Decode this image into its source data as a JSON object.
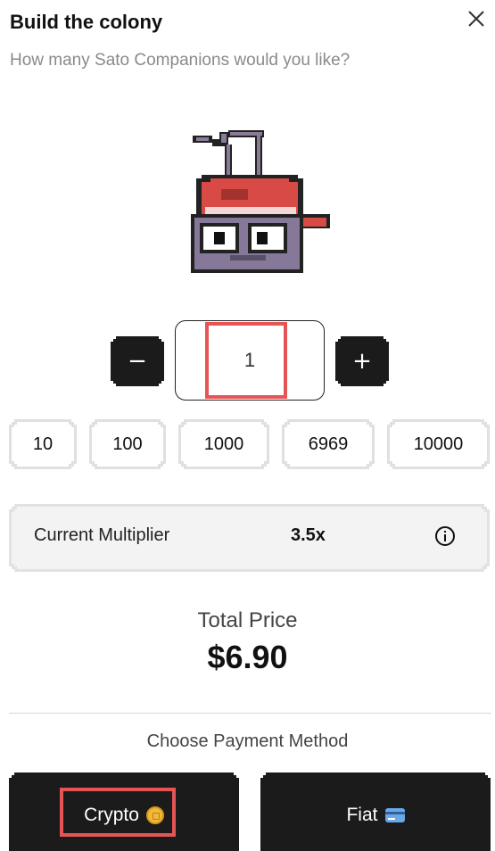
{
  "header": {
    "title": "Build the colony",
    "subtitle": "How many Sato Companions would you like?",
    "close_icon": "close-icon"
  },
  "mascot": {
    "icon": "sato-companion-mascot"
  },
  "quantity": {
    "value": "1",
    "decrement_label": "−",
    "increment_label": "+"
  },
  "presets": [
    "10",
    "100",
    "1000",
    "6969",
    "10000"
  ],
  "multiplier": {
    "label": "Current Multiplier",
    "value": "3.5x",
    "info_icon": "info-icon"
  },
  "total": {
    "label": "Total Price",
    "value": "$6.90"
  },
  "payment": {
    "label": "Choose Payment Method",
    "crypto_label": "Crypto",
    "crypto_icon": "coin-icon",
    "fiat_label": "Fiat",
    "fiat_icon": "credit-card-icon"
  },
  "colors": {
    "button_bg": "#1b1b1b",
    "highlight": "#e65555",
    "muted_text": "#8a8a8a"
  }
}
